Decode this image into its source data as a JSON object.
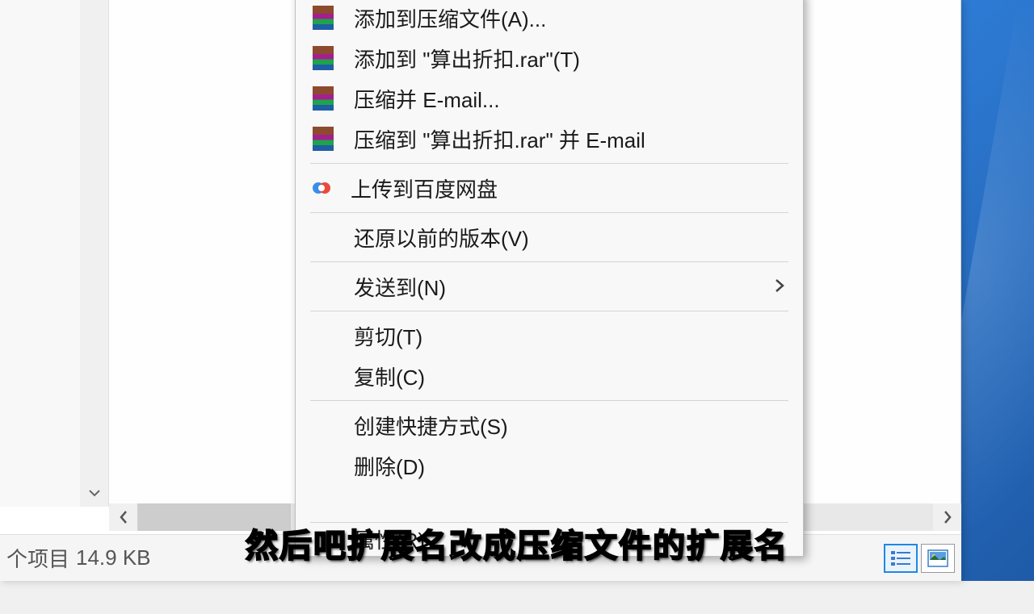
{
  "sidebar": {
    "partial_text": ""
  },
  "status": {
    "items_suffix": "个项目",
    "size": "14.9 KB"
  },
  "context_menu": {
    "add_archive": "添加到压缩文件(A)...",
    "add_to_rar": "添加到 \"算出折扣.rar\"(T)",
    "compress_email": "压缩并 E-mail...",
    "compress_to_email": "压缩到 \"算出折扣.rar\" 并 E-mail",
    "baidu_upload": "上传到百度网盘",
    "restore_versions": "还原以前的版本(V)",
    "send_to": "发送到(N)",
    "cut": "剪切(T)",
    "copy": "复制(C)",
    "create_shortcut": "创建快捷方式(S)",
    "delete": "删除(D)",
    "properties": "属性(R)"
  },
  "subtitle": "然后吧扩展名改成压缩文件的扩展名"
}
